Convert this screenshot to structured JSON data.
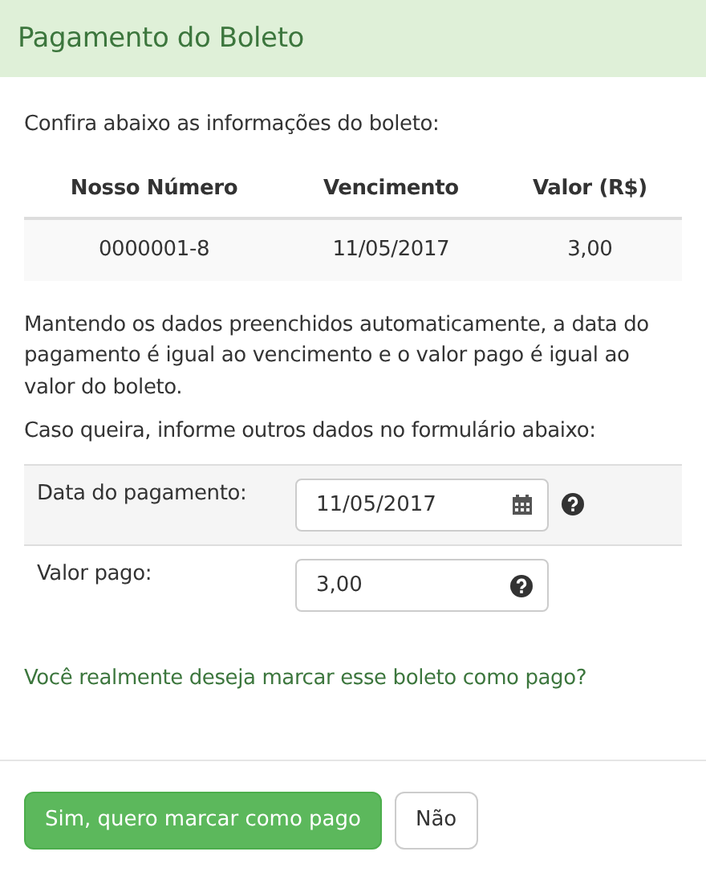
{
  "modal": {
    "title": "Pagamento do Boleto"
  },
  "intro": "Confira abaixo as informações do boleto:",
  "table": {
    "columns": [
      "Nosso Número",
      "Vencimento",
      "Valor (R$)"
    ],
    "rows": [
      [
        "0000001-8",
        "11/05/2017",
        "3,00"
      ]
    ]
  },
  "note": "Mantendo os dados preenchidos automaticamente, a data do pagamento é igual ao vencimento e o valor pago é igual ao valor do boleto.",
  "form_intro": "Caso queira, informe outros dados no formulário abaixo:",
  "fields": [
    {
      "label": "Data do pagamento:",
      "value": "11/05/2017",
      "kind": "date"
    },
    {
      "label": "Valor pago:",
      "value": "3,00",
      "kind": "money"
    }
  ],
  "question": "Você realmente deseja marcar esse boleto como pago?",
  "buttons": [
    {
      "label": "Sim, quero marcar como pago",
      "kind": "primary"
    },
    {
      "label": "Não",
      "kind": "default"
    }
  ]
}
